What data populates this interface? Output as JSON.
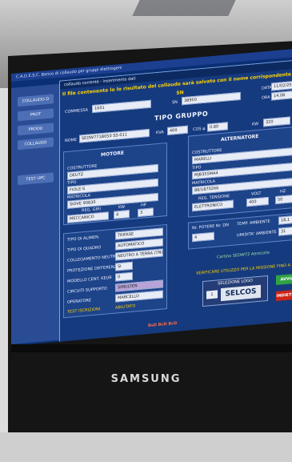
{
  "app": {
    "taskbar": "C.A.D.E.S.C.  Banco di collaudo per gruppi elettrogeni",
    "dialog_title": "collaudo corrente - inserimento dati",
    "warning": "Il file contenente lo lo risultato del collaudo sarà salvato con il nome corrispondente al SN",
    "sidebar": [
      "COLLAUDO D",
      "PROT",
      "PRODU",
      "COLLAUDO",
      "TEST UPC"
    ]
  },
  "header": {
    "commessa_label": "COMMESSA",
    "commessa_value": "1601",
    "sn_label": "SN",
    "sn_value": "38950",
    "data_label": "DATA",
    "data_value": "11/02/2014",
    "ora_label": "ORA",
    "ora_value": "14.08"
  },
  "gruppo": {
    "title": "TIPO GRUPPO",
    "nome_label": "NOME",
    "nome_value": "SEDW771B050 SS-011",
    "kva_label": "KVA",
    "kva_value": "400",
    "cos_label": "COS φ",
    "cos_value": "0.80",
    "kw_label": "KW",
    "kw_value": "320"
  },
  "motore": {
    "title": "MOTORE",
    "costruttore_label": "COSTRUTTORE",
    "costruttore_value": "DEUTZ",
    "tipo_label": "TIPO",
    "tipo_value": "FIOLE-S",
    "matricola_label": "MATRICOLA",
    "matricola_value": "SIOVE 90830",
    "reg_giri_label": "REG. GIRI",
    "reg_giri_value": "MECCANICO",
    "nr_label": "KW",
    "nr_value": "4",
    "hp_label": "HP",
    "hp_value": "3"
  },
  "alternatore": {
    "title": "ALTERNATORE",
    "costruttore_label": "COSTRUTTORE",
    "costruttore_value": "MARELLI",
    "tipo_label": "TIPO",
    "tipo_value": "MJB355MA4",
    "matricola_label": "MATRICOLA",
    "matricola_value": "88/1870266",
    "reg_tensione_label": "REG. TENSIONE",
    "reg_tensione_value": "ELETTRONICO",
    "volt_label": "VOLT",
    "volt_value": "400",
    "hz_label": "HZ",
    "hz_value": "50"
  },
  "opzioni": [
    {
      "label": "TIPO DI ALIMEN.",
      "value": "TRIFASE"
    },
    {
      "label": "TIPO DI QUADRO",
      "value": "AUTOMATICO"
    },
    {
      "label": "COLLEGAMENTO NEUTRO-TERRA",
      "value": "NEUTRO A TERRA (TN)"
    },
    {
      "label": "PROTEZIONE DIFFERENZIALE",
      "value": "SI"
    },
    {
      "label": "MODELLO CENT. KEUR",
      "value": "0"
    },
    {
      "label": "CIRCUITI SUPPORTO",
      "value": "SIMULTEN"
    },
    {
      "label": "OPERATORE",
      "value": "MARCELLO"
    }
  ],
  "test_iscrizioni": {
    "label": "TEST ISCRIZIONI",
    "check": "ABILITATO"
  },
  "misure": {
    "nr_poli_label": "Nr. POTERE Nr. DN",
    "nr_poli_value": "4",
    "temp_label": "TEMP. AMBIENTE",
    "temp_value": "18,1",
    "umidita_label": "UMIDITA' AMBIENTE",
    "umidita_value": "31"
  },
  "status": {
    "dati_label": "Cartino SEDW72 Aerocollo",
    "avviso": "VERIFICARE UTILIZZO PER LA MISSIONE FINO A GRUPPO"
  },
  "logo": {
    "title": "SELEZIONE LOGO",
    "value": "SELCOS",
    "index": "1"
  },
  "buttons": {
    "avvia": "AVVIA",
    "indietro": "INDIETRO"
  },
  "footer": {
    "text": "BsD BcD BcD"
  },
  "brand": "SAMSUNG"
}
